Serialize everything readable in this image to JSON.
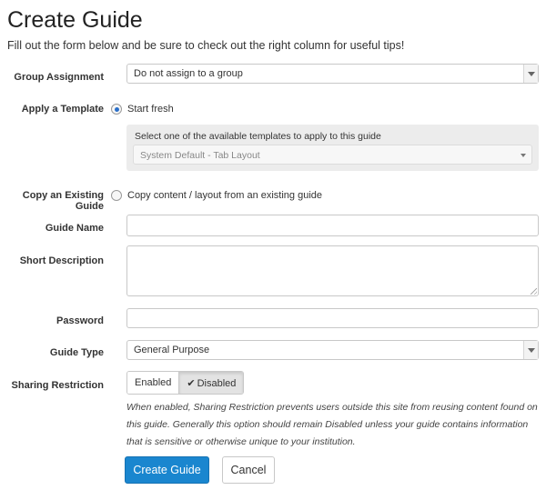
{
  "page": {
    "title": "Create Guide",
    "intro": "Fill out the form below and be sure to check out the right column for useful tips!"
  },
  "group_assignment": {
    "label": "Group Assignment",
    "value": "Do not assign to a group"
  },
  "template": {
    "label": "Apply a Template",
    "option_label": "Start fresh",
    "selected": true,
    "select_prompt": "Select one of the available templates to apply to this guide",
    "select_value": "System Default - Tab Layout"
  },
  "copy_guide": {
    "label": "Copy an Existing Guide",
    "option_label": "Copy content / layout from an existing guide",
    "selected": false
  },
  "guide_name": {
    "label": "Guide Name",
    "value": ""
  },
  "short_description": {
    "label": "Short Description",
    "value": ""
  },
  "password": {
    "label": "Password",
    "value": ""
  },
  "guide_type": {
    "label": "Guide Type",
    "value": "General Purpose"
  },
  "sharing": {
    "label": "Sharing Restriction",
    "enabled_label": "Enabled",
    "disabled_label": "Disabled",
    "selected": "Disabled",
    "help": "When enabled, Sharing Restriction prevents users outside this site from reusing content found on this guide. Generally this option should remain Disabled unless your guide contains information that is sensitive or otherwise unique to your institution."
  },
  "actions": {
    "create_label": "Create Guide",
    "cancel_label": "Cancel"
  },
  "colors": {
    "primary_button": "#1a86cf",
    "radio_selected": "#2a6fc9"
  }
}
